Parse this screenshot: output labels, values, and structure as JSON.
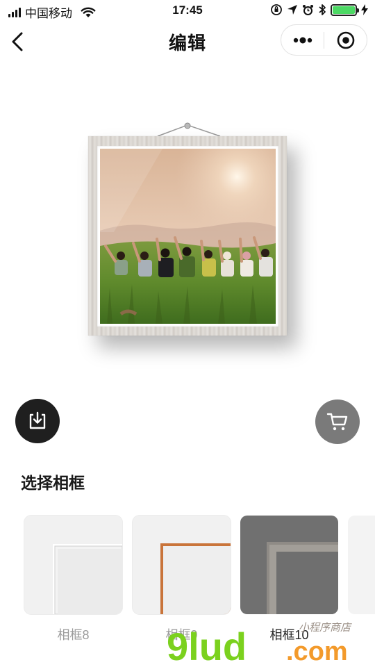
{
  "status_bar": {
    "carrier": "中国移动",
    "time": "17:45"
  },
  "nav": {
    "title": "编辑",
    "back_icon": "chevron-left-icon",
    "menu_icon": "more-dots-icon",
    "close_icon": "target-circle-icon"
  },
  "actions": {
    "download_icon": "download-icon",
    "cart_icon": "shopping-cart-icon"
  },
  "section": {
    "title": "选择相框"
  },
  "frames": [
    {
      "label": "相框8",
      "style": "white-thin"
    },
    {
      "label": "相框9",
      "style": "wood-orange"
    },
    {
      "label": "相框10",
      "style": "gray-wood",
      "selected": true
    },
    {
      "label": "",
      "style": "partial"
    }
  ],
  "watermark": {
    "brand": "9lud",
    "suffix": ".com",
    "tagline": "小程序商店"
  },
  "colors": {
    "selected_label": "#222222",
    "unselected_label": "#9a9a9a",
    "download_button": "#1f1f1f",
    "cart_button": "#7a7a7a",
    "battery_fill": "#4cd964",
    "watermark_green": "#7bd11e",
    "watermark_orange": "#f39a2b"
  }
}
